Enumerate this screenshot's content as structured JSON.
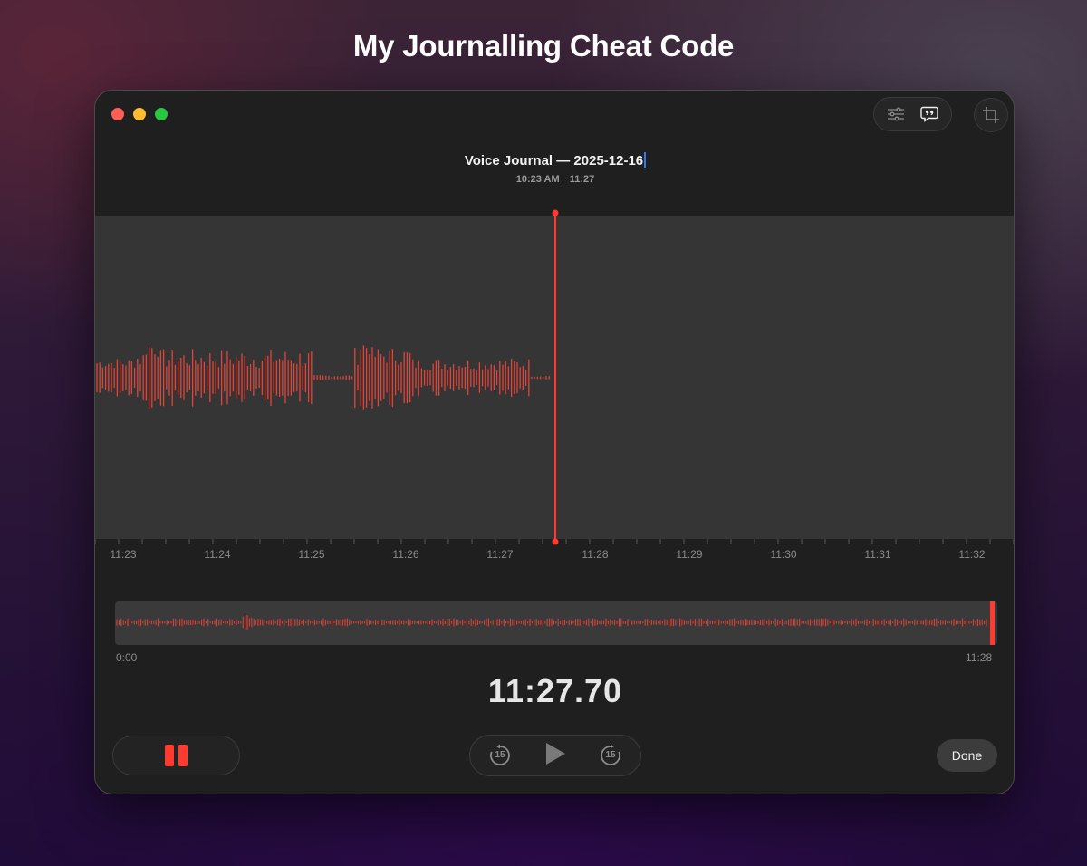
{
  "headline": "My Journalling Cheat Code",
  "toolbar": {
    "options_icon": "sliders-icon",
    "transcript_icon": "quote-bubble-icon",
    "crop_icon": "crop-icon"
  },
  "recording": {
    "title": "Voice Journal — 2025-12-16",
    "time_of_day": "10:23 AM",
    "duration": "11:27"
  },
  "timeline": {
    "ticks": [
      "11:23",
      "11:24",
      "11:25",
      "11:26",
      "11:27",
      "11:28",
      "11:29",
      "11:30",
      "11:31",
      "11:32"
    ],
    "playhead_time": "11:27.70"
  },
  "overview": {
    "start_label": "0:00",
    "end_label": "11:28"
  },
  "timer": "11:27.70",
  "controls": {
    "pause_icon": "pause-icon",
    "skip_back_label": "15",
    "play_icon": "play-icon",
    "skip_forward_label": "15",
    "done_label": "Done"
  },
  "colors": {
    "accent": "#ff3b30",
    "waveform": "#e0443a",
    "window": "#1f1f1f",
    "wave_bg": "#353535"
  }
}
